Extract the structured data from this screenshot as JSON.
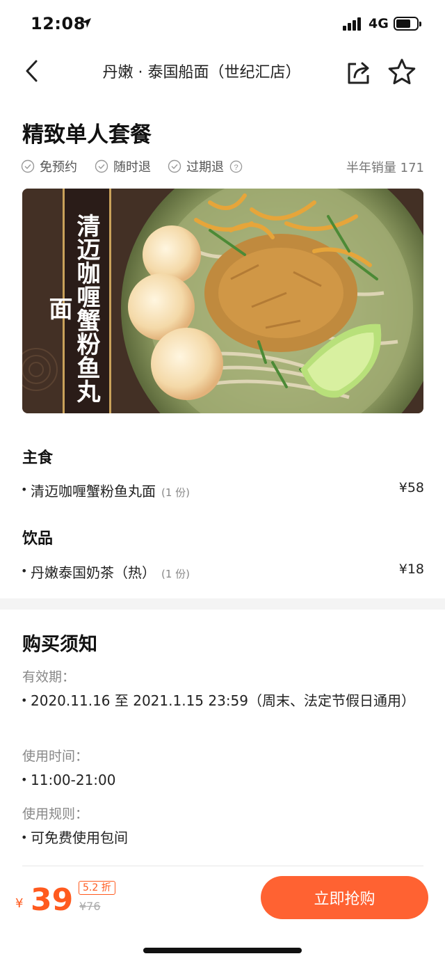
{
  "status": {
    "time": "12:08",
    "network": "4G",
    "icons": [
      "location-arrow-icon",
      "signal-icon",
      "battery-icon"
    ]
  },
  "nav": {
    "title": "丹嫩 · 泰国船面（世纪汇店）",
    "icons": [
      "back-icon",
      "share-icon",
      "star-icon"
    ]
  },
  "deal": {
    "title": "精致单人套餐",
    "tags": [
      "免预约",
      "随时退",
      "过期退"
    ],
    "sales": "半年销量 171"
  },
  "hero": {
    "banner_text": "清迈咖喱蟹粉鱼丸面"
  },
  "menu": {
    "sections": [
      {
        "title": "主食",
        "items": [
          {
            "name": "清迈咖喱蟹粉鱼丸面",
            "qty": "(1 份)",
            "price": "¥58"
          }
        ]
      },
      {
        "title": "饮品",
        "items": [
          {
            "name": "丹嫩泰国奶茶（热）",
            "qty": "(1 份)",
            "price": "¥18"
          }
        ]
      }
    ]
  },
  "notice": {
    "title": "购买须知",
    "validity_label": "有效期：",
    "validity_value": "2020.11.16 至 2021.1.15 23:59（周末、法定节假日通用）",
    "hours_label": "使用时间：",
    "hours_value": "11:00-21:00",
    "rules_label": "使用规则：",
    "rules_value": "可免费使用包间"
  },
  "purchase": {
    "currency": "¥",
    "price": "39",
    "discount": "5.2 折",
    "original_price": "¥76",
    "buy_label": "立即抢购"
  },
  "colors": {
    "accent": "#ff5a1e",
    "button": "#ff6232"
  }
}
